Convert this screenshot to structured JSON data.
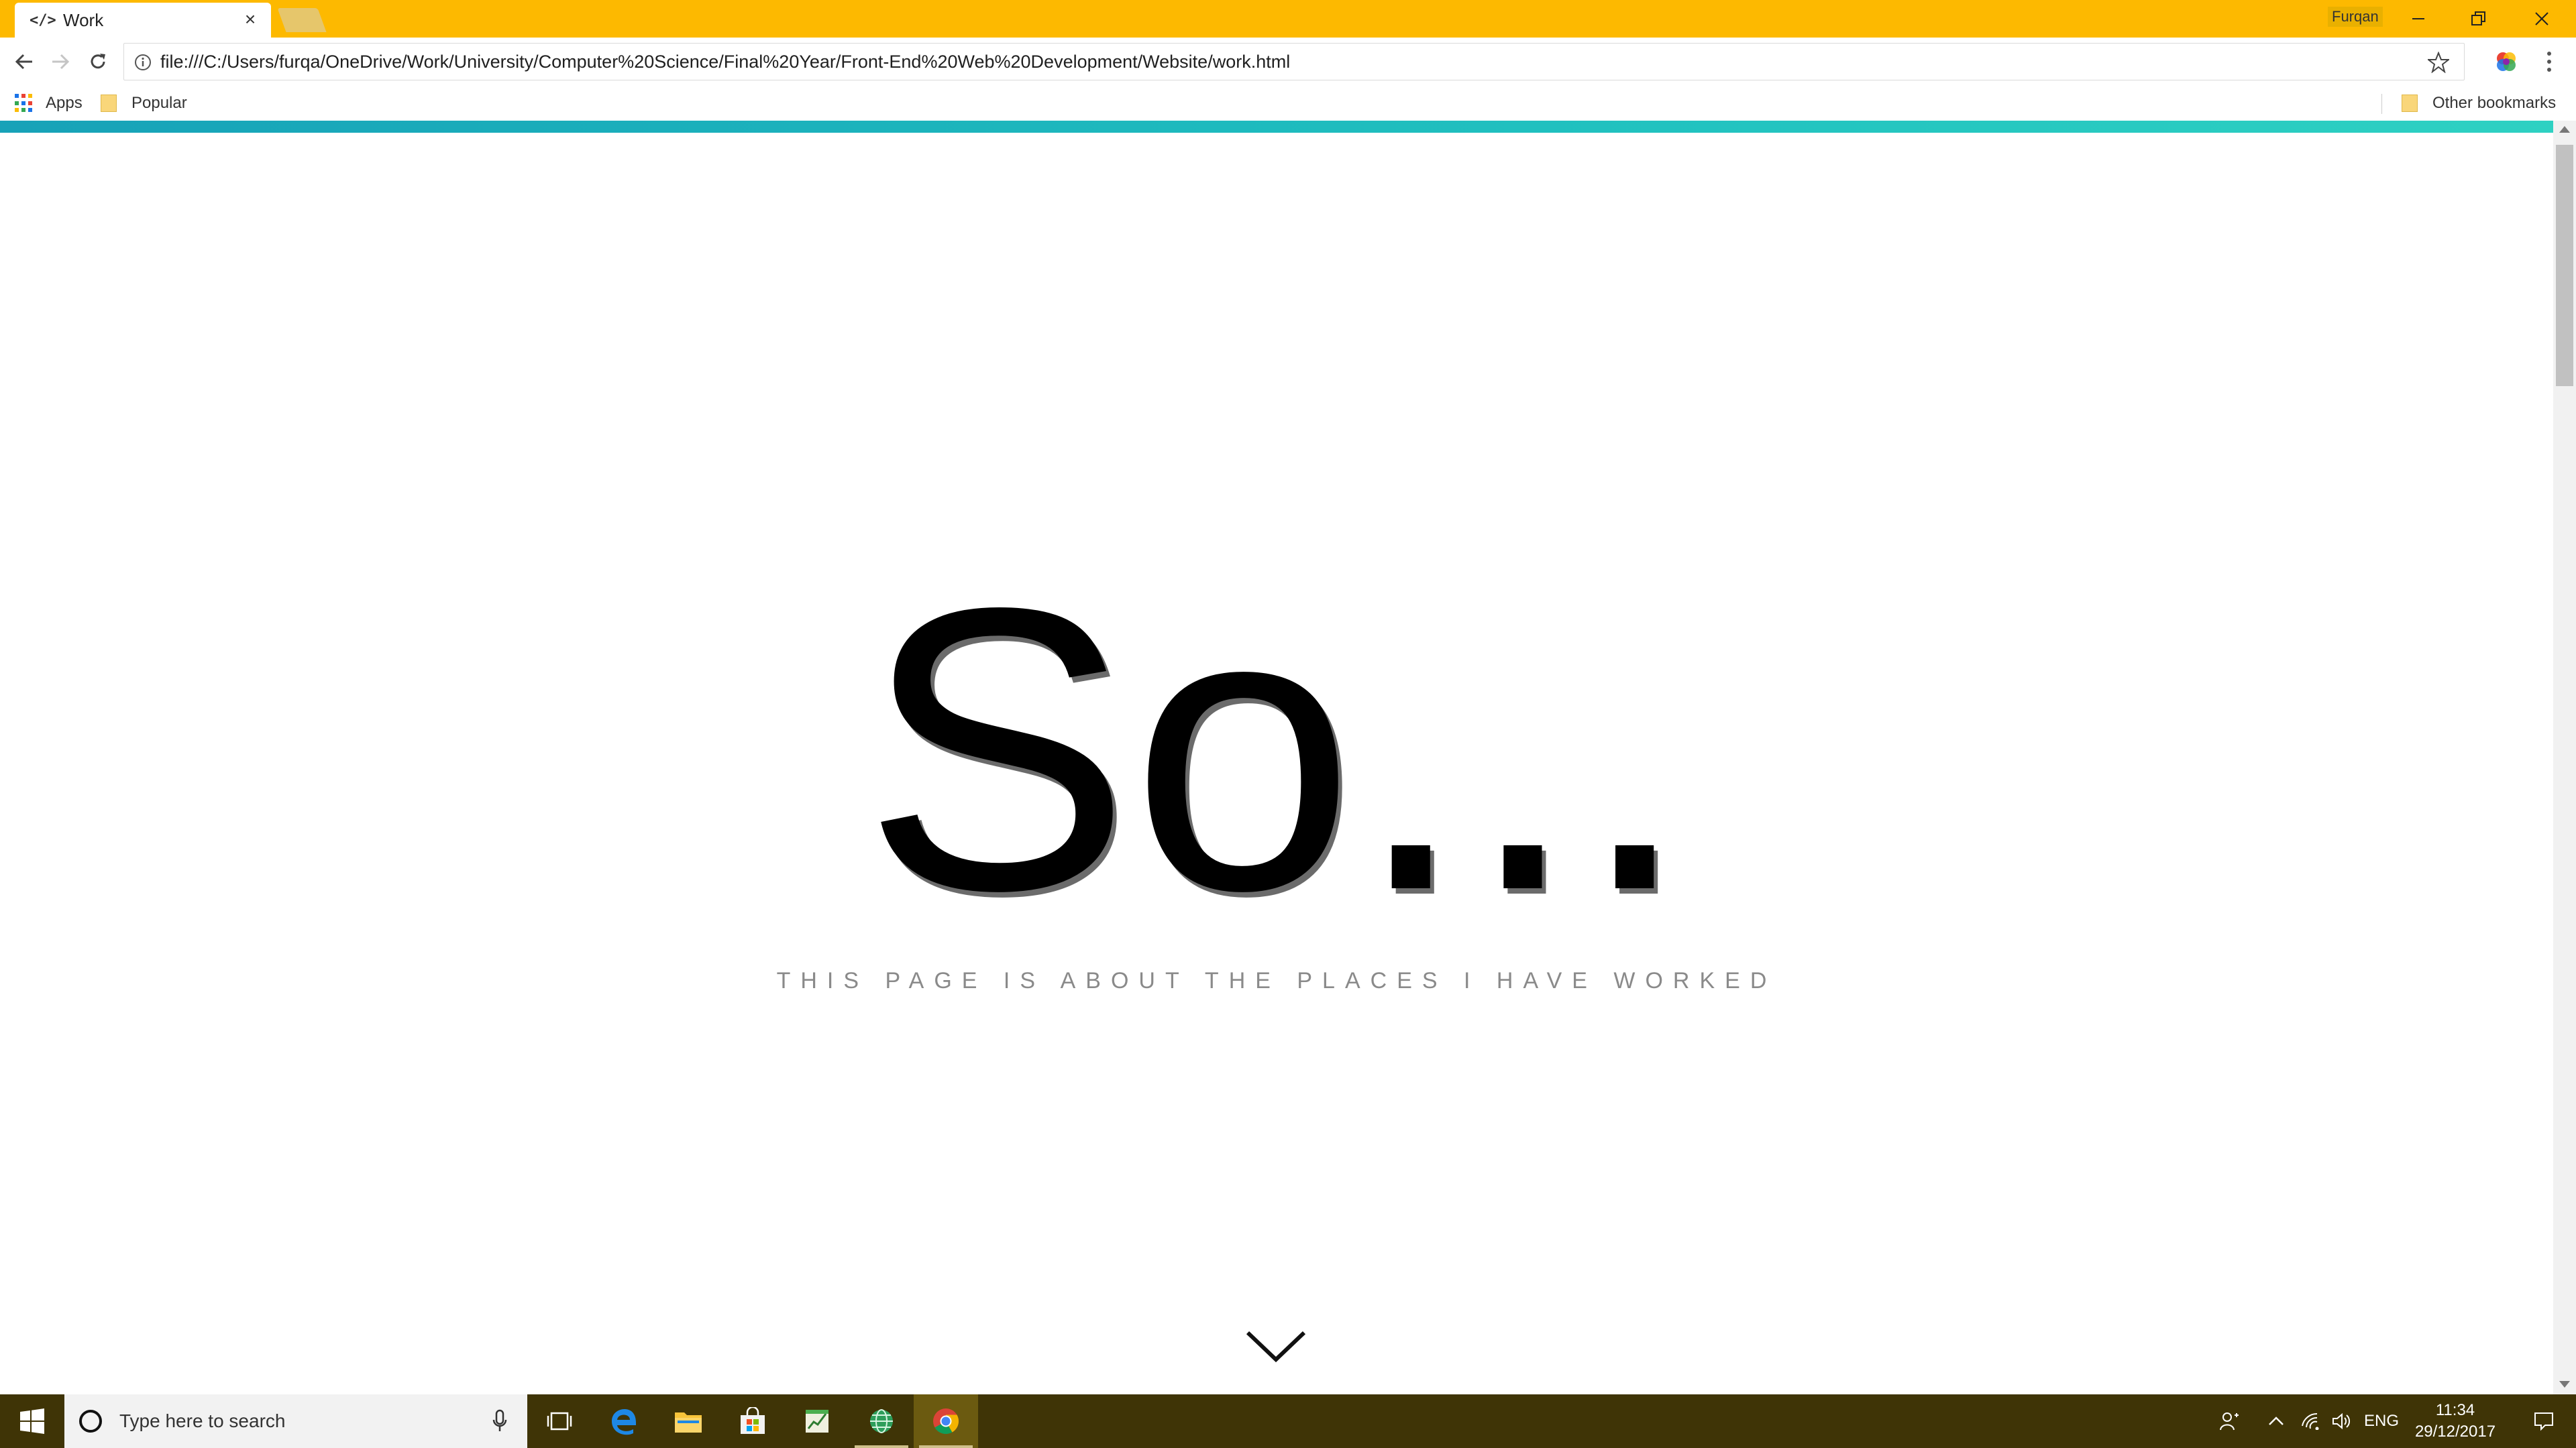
{
  "browser": {
    "tab": {
      "icon_text": "</>",
      "title": "Work",
      "close_glyph": "×"
    },
    "profile_name": "Furqan",
    "url": "file:///C:/Users/furqa/OneDrive/Work/University/Computer%20Science/Final%20Year/Front-End%20Web%20Development/Website/work.html",
    "bookmarks": {
      "apps_label": "Apps",
      "popular_label": "Popular",
      "other_label": "Other bookmarks"
    }
  },
  "page": {
    "title": "So...",
    "subtitle": "THIS PAGE IS ABOUT THE PLACES I HAVE WORKED"
  },
  "taskbar": {
    "search_placeholder": "Type here to search",
    "language": "ENG",
    "time": "11:34",
    "date": "29/12/2017"
  },
  "colors": {
    "titlebar": "#FDB900",
    "accent_strip": "#20c0bf",
    "taskbar": "#3f3406"
  }
}
